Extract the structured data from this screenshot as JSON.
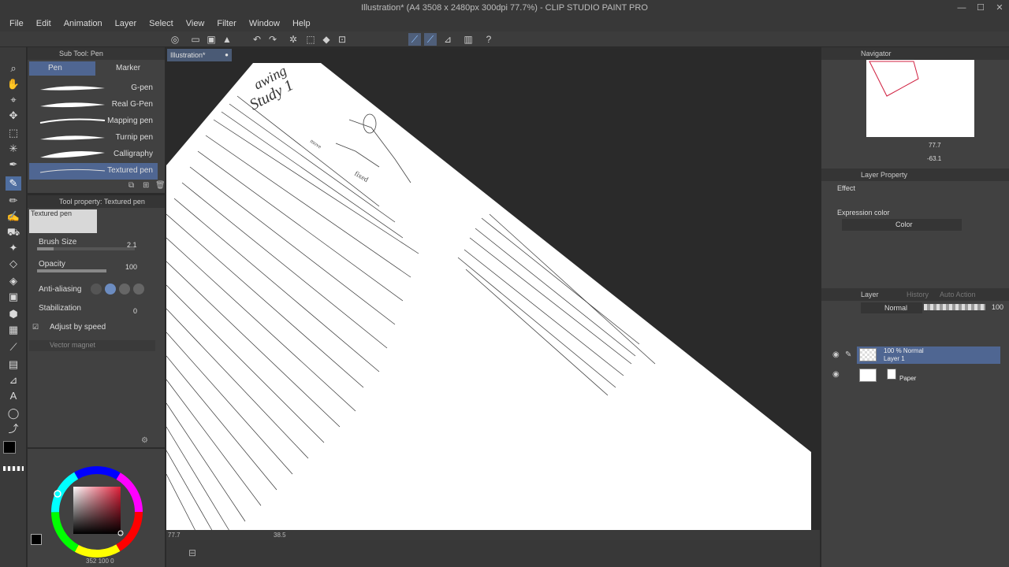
{
  "window": {
    "title": "Illustration* (A4 3508 x 2480px 300dpi 77.7%)  - CLIP STUDIO PAINT PRO"
  },
  "menu": [
    "File",
    "Edit",
    "Animation",
    "Layer",
    "Select",
    "View",
    "Filter",
    "Window",
    "Help"
  ],
  "subtool": {
    "header": "Sub Tool: Pen",
    "tabs": [
      "Pen",
      "Marker"
    ],
    "brushes": [
      "G-pen",
      "Real G-Pen",
      "Mapping pen",
      "Turnip pen",
      "Calligraphy",
      "Textured pen"
    ],
    "selected": "Textured pen"
  },
  "toolprop": {
    "header": "Tool property: Textured pen",
    "preview_label": "Textured pen",
    "brush_size_label": "Brush Size",
    "brush_size": "2.1",
    "brush_size_fill": 0.17,
    "opacity_label": "Opacity",
    "opacity": "100",
    "opacity_fill": 1.0,
    "antialias_label": "Anti-aliasing",
    "stabilization_label": "Stabilization",
    "stabilization": "0",
    "adjust_label": "Adjust by speed",
    "vector_label": "Vector magnet"
  },
  "document": {
    "tab": "Illustration*"
  },
  "canvas_status": {
    "zoom": "77.7",
    "angle": "38.5"
  },
  "color": {
    "main": "#000000",
    "sub": "#ffffff",
    "readout": "352 100 0"
  },
  "navigator": {
    "header": "Navigator",
    "zoom": "77.7",
    "angle": "-63.1"
  },
  "layer_property": {
    "header": "Layer Property",
    "effect_label": "Effect",
    "expression_label": "Expression color",
    "expression_value": "Color"
  },
  "layer_panel": {
    "tabs": [
      "Layer",
      "History",
      "Auto Action"
    ],
    "blend_mode": "Normal",
    "opacity": "100",
    "layers": [
      {
        "line1": "100 % Normal",
        "line2": "Layer 1"
      },
      {
        "line1": "",
        "line2": "Paper"
      }
    ]
  },
  "sketch_text": {
    "line1": "awing",
    "line2": "Study 1",
    "move": "move",
    "fixed": "fixed"
  }
}
